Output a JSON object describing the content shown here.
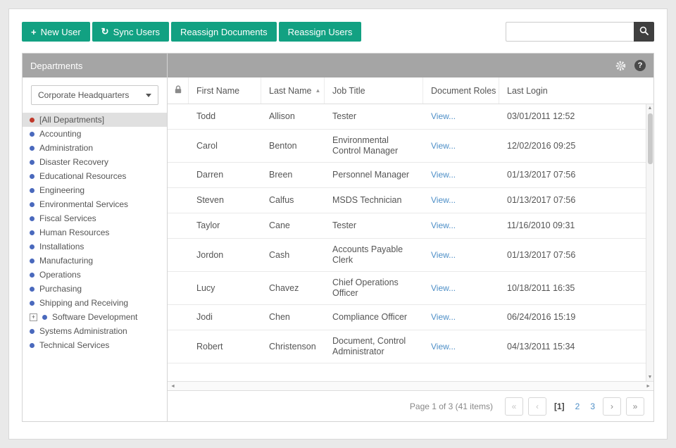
{
  "colors": {
    "accent_green": "#12A182",
    "panel_header_gray": "#A5A5A5",
    "link_blue": "#4E8FC7",
    "dot_blue": "#4A69BD",
    "dot_red": "#C0392B",
    "selected_item_bg": "#E0E0E0",
    "search_button_bg": "#3F3F3F"
  },
  "icons": {
    "plus": "+",
    "sync": "↻",
    "help": "?",
    "sort_asc": "▲",
    "expand": "+",
    "scroll_up": "▲",
    "scroll_down": "▼",
    "scroll_left": "◄",
    "scroll_right": "►"
  },
  "toolbar": {
    "new_user": "New User",
    "sync_users": "Sync Users",
    "reassign_documents": "Reassign Documents",
    "reassign_users": "Reassign Users",
    "search": {
      "value": "",
      "placeholder": ""
    }
  },
  "sidebar": {
    "title": "Departments",
    "dropdown_value": "Corporate Headquarters",
    "items": [
      "[All Departments]",
      "Accounting",
      "Administration",
      "Disaster Recovery",
      "Educational Resources",
      "Engineering",
      "Environmental Services",
      "Fiscal Services",
      "Human Resources",
      "Installations",
      "Manufacturing",
      "Operations",
      "Purchasing",
      "Shipping and Receiving",
      "Software Development",
      "Systems Administration",
      "Technical Services"
    ]
  },
  "table": {
    "columns": [
      "First Name",
      "Last Name",
      "Job Title",
      "Document Roles",
      "Last Login"
    ],
    "rows": [
      {
        "first_name": "Todd",
        "last_name": "Allison",
        "job_title": "Tester",
        "roles": "View...",
        "last_login": "03/01/2011 12:52"
      },
      {
        "first_name": "Carol",
        "last_name": "Benton",
        "job_title": "Environmental Control Manager",
        "roles": "View...",
        "last_login": "12/02/2016 09:25"
      },
      {
        "first_name": "Darren",
        "last_name": "Breen",
        "job_title": "Personnel Manager",
        "roles": "View...",
        "last_login": "01/13/2017 07:56"
      },
      {
        "first_name": "Steven",
        "last_name": "Calfus",
        "job_title": "MSDS Technician",
        "roles": "View...",
        "last_login": "01/13/2017 07:56"
      },
      {
        "first_name": "Taylor",
        "last_name": "Cane",
        "job_title": "Tester",
        "roles": "View...",
        "last_login": "11/16/2010 09:31"
      },
      {
        "first_name": "Jordon",
        "last_name": "Cash",
        "job_title": "Accounts Payable Clerk",
        "roles": "View...",
        "last_login": "01/13/2017 07:56"
      },
      {
        "first_name": "Lucy",
        "last_name": "Chavez",
        "job_title": "Chief Operations Officer",
        "roles": "View...",
        "last_login": "10/18/2011 16:35"
      },
      {
        "first_name": "Jodi",
        "last_name": "Chen",
        "job_title": "Compliance Officer",
        "roles": "View...",
        "last_login": "06/24/2016 15:19"
      },
      {
        "first_name": "Robert",
        "last_name": "Christenson",
        "job_title": "Document, Control Administrator",
        "roles": "View...",
        "last_login": "04/13/2011 15:34"
      }
    ]
  },
  "pagination": {
    "summary": "Page 1 of 3 (41 items)",
    "first": "«",
    "prev": "‹",
    "next": "›",
    "last": "»",
    "current_page": "[1]",
    "page_2": "2",
    "page_3": "3"
  }
}
